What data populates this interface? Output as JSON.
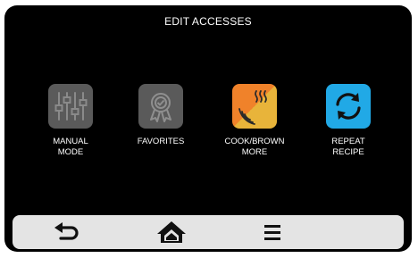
{
  "header": {
    "title": "EDIT ACCESSES"
  },
  "tiles": [
    {
      "label": "MANUAL\nMODE",
      "icon": "sliders-icon",
      "color": "#5a5a5a"
    },
    {
      "label": "FAVORITES",
      "icon": "award-ribbon-icon",
      "color": "#5a5a5a"
    },
    {
      "label": "COOK/BROWN\nMORE",
      "icon": "heat-waves-icon",
      "color_top": "#f0822a",
      "color_bottom": "#e8b43a"
    },
    {
      "label": "REPEAT\nRECIPE",
      "icon": "repeat-arrows-icon",
      "color": "#21a9e6"
    }
  ],
  "bottom_bar": {
    "items": [
      {
        "icon": "back-arrow-icon"
      },
      {
        "icon": "home-icon"
      },
      {
        "icon": "menu-icon"
      }
    ]
  }
}
